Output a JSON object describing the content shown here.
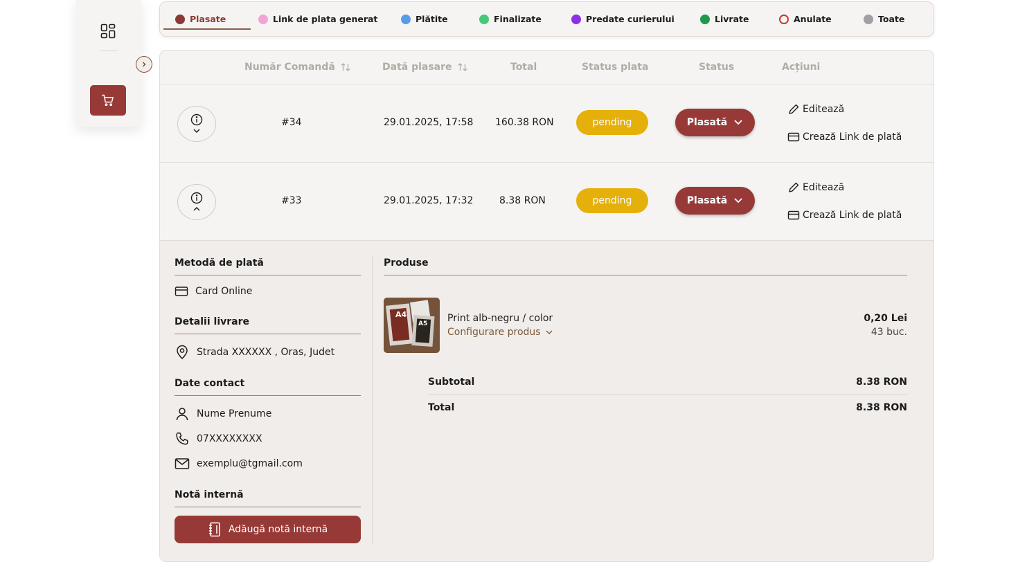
{
  "colors": {
    "accent": "#973a37",
    "pending": "#e6b00a"
  },
  "tabs": [
    {
      "label": "Plasate",
      "color": "#8a3a34",
      "type": "filled",
      "active": true
    },
    {
      "label": "Link de plata generat",
      "color": "#f0a6d4",
      "type": "filled"
    },
    {
      "label": "Plătite",
      "color": "#5a9be8",
      "type": "filled"
    },
    {
      "label": "Finalizate",
      "color": "#44c97a",
      "type": "filled"
    },
    {
      "label": "Predate curierului",
      "color": "#8a33e6",
      "type": "filled"
    },
    {
      "label": "Livrate",
      "color": "#1f9a4a",
      "type": "filled"
    },
    {
      "label": "Anulate",
      "color": "#c23a2e",
      "type": "ring"
    },
    {
      "label": "Toate",
      "color": "#a0a0a5",
      "type": "filled"
    }
  ],
  "table": {
    "headers": {
      "order": "Număr Comandă",
      "date": "Dată plasare",
      "total": "Total",
      "payment_status": "Status plata",
      "status": "Status",
      "actions": "Acțiuni"
    },
    "rows": [
      {
        "order": "#34",
        "date": "29.01.2025, 17:58",
        "total": "160.38 RON",
        "payment_status": "pending",
        "status": "Plasată",
        "action_edit": "Editează",
        "action_link": "Crează Link de plată",
        "expanded": false
      },
      {
        "order": "#33",
        "date": "29.01.2025, 17:32",
        "total": "8.38 RON",
        "payment_status": "pending",
        "status": "Plasată",
        "action_edit": "Editează",
        "action_link": "Crează Link de plată",
        "expanded": true
      }
    ]
  },
  "details": {
    "payment_title": "Metodă de plată",
    "payment_method": "Card Online",
    "delivery_title": "Detalii livrare",
    "address": "Strada XXXXXX , Oras, Judet",
    "contact_title": "Date contact",
    "name": "Nume Prenume",
    "phone": "07XXXXXXXX",
    "email": "exemplu@tgmail.com",
    "note_title": "Notă internă",
    "note_button": "Adăugă notă internă",
    "products_title": "Produse",
    "product": {
      "name": "Print alb-negru / color",
      "configure": "Configurare produs",
      "price": "0,20 Lei",
      "qty": "43 buc."
    },
    "subtotal_label": "Subtotal",
    "subtotal": "8.38 RON",
    "total_label": "Total",
    "total": "8.38 RON"
  }
}
